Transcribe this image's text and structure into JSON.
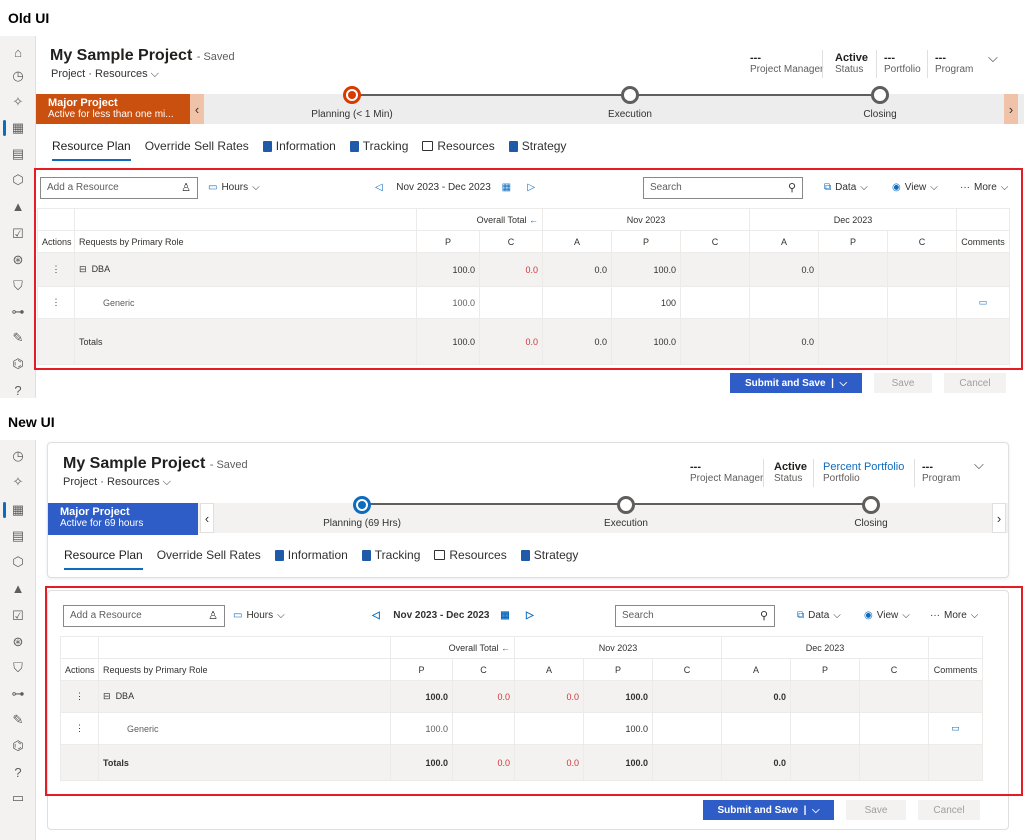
{
  "old": {
    "label": "Old UI",
    "title": "My Sample Project",
    "saved": "- Saved",
    "crumb_a": "Project",
    "crumb_b": "Resources",
    "fields": [
      {
        "v": "---",
        "l": "Project Manager"
      },
      {
        "v": "Active",
        "l": "Status"
      },
      {
        "v": "---",
        "l": "Portfolio"
      },
      {
        "v": "---",
        "l": "Program"
      }
    ],
    "badge_t": "Major Project",
    "badge_s": "Active for less than one mi...",
    "stages": [
      "Planning  (< 1 Min)",
      "Execution",
      "Closing"
    ],
    "tabs": [
      "Resource Plan",
      "Override Sell Rates",
      "Information",
      "Tracking",
      "Resources",
      "Strategy"
    ],
    "add": "Add a Resource",
    "hours": "Hours",
    "range": "Nov 2023 - Dec 2023",
    "search": "Search",
    "data": "Data",
    "view": "View",
    "more": "More",
    "submit": "Submit and Save",
    "save": "Save",
    "cancel": "Cancel"
  },
  "new": {
    "label": "New UI",
    "title": "My Sample Project",
    "saved": "- Saved",
    "crumb_a": "Project",
    "crumb_b": "Resources",
    "fields": [
      {
        "v": "---",
        "l": "Project Manager"
      },
      {
        "v": "Active",
        "l": "Status"
      },
      {
        "v": "Percent Portfolio",
        "l": "Portfolio"
      },
      {
        "v": "---",
        "l": "Program"
      }
    ],
    "badge_t": "Major Project",
    "badge_s": "Active for 69 hours",
    "stages": [
      "Planning  (69 Hrs)",
      "Execution",
      "Closing"
    ],
    "tabs": [
      "Resource Plan",
      "Override Sell Rates",
      "Information",
      "Tracking",
      "Resources",
      "Strategy"
    ],
    "add": "Add a Resource",
    "hours": "Hours",
    "range": "Nov 2023 - Dec 2023",
    "search": "Search",
    "data": "Data",
    "view": "View",
    "more": "More",
    "submit": "Submit and Save",
    "save": "Save",
    "cancel": "Cancel"
  },
  "grid": {
    "overall": "Overall Total",
    "nov": "Nov 2023",
    "dec": "Dec 2023",
    "actions": "Actions",
    "role": "Requests by Primary Role",
    "comments": "Comments",
    "p": "P",
    "c": "C",
    "a": "A",
    "dba": "DBA",
    "generic": "Generic",
    "totals": "Totals",
    "v100": "100.0",
    "v0": "0.0",
    "v100i": "100"
  },
  "colors": {
    "old_badge": "#ca5010",
    "new_badge": "#2f5dc8",
    "accent": "#0f6cbd",
    "red": "#e51c23"
  }
}
